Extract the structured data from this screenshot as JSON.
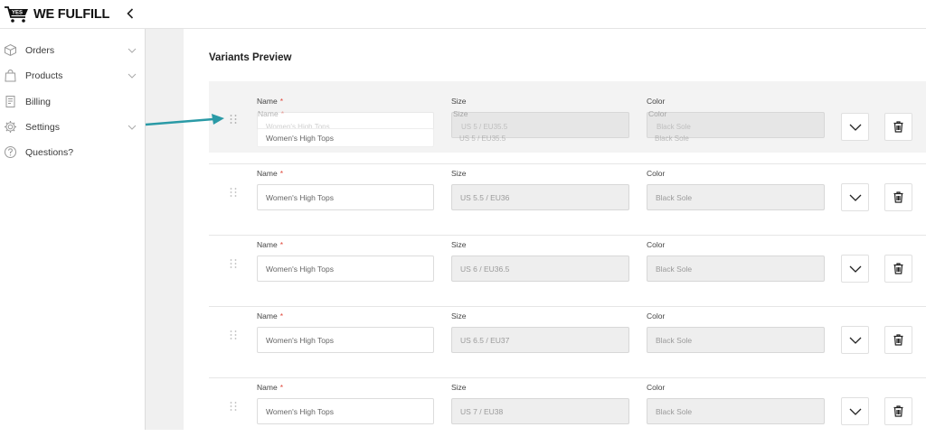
{
  "brand": {
    "name": "WE FULFILL",
    "badge": "YES",
    "accent": "#2a9aa6"
  },
  "sidebar": {
    "items": [
      {
        "label": "Orders",
        "icon": "box-icon",
        "has_chevron": true
      },
      {
        "label": "Products",
        "icon": "bag-icon",
        "has_chevron": true
      },
      {
        "label": "Billing",
        "icon": "receipt-icon",
        "has_chevron": false
      },
      {
        "label": "Settings",
        "icon": "gear-icon",
        "has_chevron": true
      },
      {
        "label": "Questions?",
        "icon": "question-icon",
        "has_chevron": false
      }
    ]
  },
  "main": {
    "title": "Variants Preview",
    "labels": {
      "name": "Name",
      "size": "Size",
      "color": "Color",
      "required_mark": "*"
    },
    "dragging_row": {
      "name": "Women's High Tops",
      "size": "US 5 / EU35.5",
      "color": "Black Sole"
    },
    "variants": [
      {
        "name": "Women's High Tops",
        "size": "US 5.5 / EU36",
        "color": "Black Sole"
      },
      {
        "name": "Women's High Tops",
        "size": "US 6 / EU36.5",
        "color": "Black Sole"
      },
      {
        "name": "Women's High Tops",
        "size": "US 6.5 / EU37",
        "color": "Black Sole"
      },
      {
        "name": "Women's High Tops",
        "size": "US 7 / EU38",
        "color": "Black Sole"
      }
    ]
  }
}
